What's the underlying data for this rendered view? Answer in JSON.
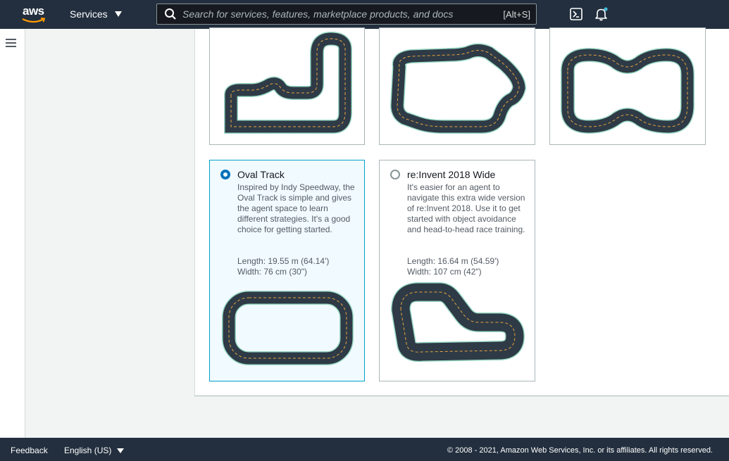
{
  "header": {
    "logo_text": "aws",
    "services_label": "Services",
    "search_placeholder": "Search for services, features, marketplace products, and docs",
    "search_shortcut": "[Alt+S]"
  },
  "tracks": [
    {
      "title": "Oval Track",
      "selected": true,
      "description": "Inspired by Indy Speedway, the Oval Track is simple and gives the agent space to learn different strategies. It's a good choice for getting started.",
      "length": "Length: 19.55 m (64.14')",
      "width": "Width: 76 cm (30\")"
    },
    {
      "title": "re:Invent 2018 Wide",
      "selected": false,
      "description": "It's easier for an agent to navigate this extra wide version of re:Invent 2018. Use it to get started with object avoidance and head-to-head race training.",
      "length": "Length: 16.64 m (54.59')",
      "width": "Width: 107 cm (42\")"
    }
  ],
  "footer": {
    "feedback": "Feedback",
    "language": "English (US)",
    "copyright": "© 2008 - 2021, Amazon Web Services, Inc. or its affiliates. All rights reserved."
  },
  "colors": {
    "nav_bg": "#232f3e",
    "selected_border": "#00a1c9",
    "selected_bg": "#f1faff",
    "radio_on": "#0073bb",
    "track_asphalt": "#2e3a46",
    "track_line": "#e8a33d",
    "track_edge": "#9ad9c5"
  }
}
